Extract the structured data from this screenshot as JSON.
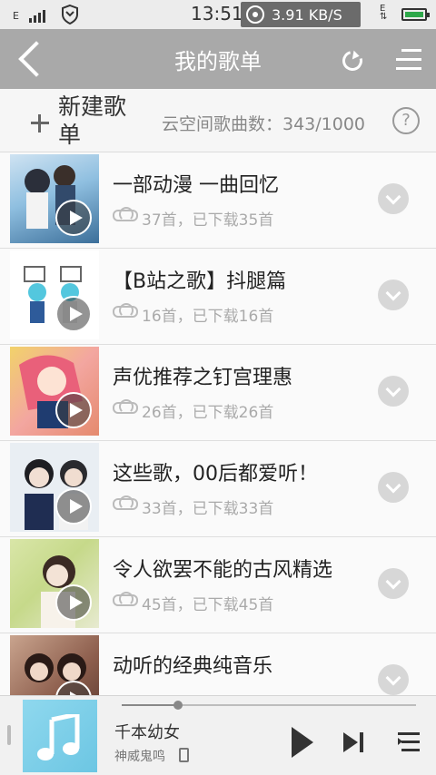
{
  "status_bar": {
    "network": "E",
    "time": "13:51",
    "speed": "3.91 KB/S",
    "data_label": "E"
  },
  "header": {
    "title": "我的歌单"
  },
  "new_bar": {
    "new_label": "新建歌单",
    "cloud_count": "云空间歌曲数：343/1000",
    "help": "?"
  },
  "playlists": [
    {
      "title": "一部动漫 一曲回忆",
      "sub": "37首，已下载35首"
    },
    {
      "title": "【B站之歌】抖腿篇",
      "sub": "16首，已下载16首"
    },
    {
      "title": "声优推荐之钉宫理惠",
      "sub": "26首，已下载26首"
    },
    {
      "title": "这些歌，00后都爱听！",
      "sub": "33首，已下载33首"
    },
    {
      "title": "令人欲罢不能的古风精选",
      "sub": "45首，已下载45首"
    },
    {
      "title": "动听的经典纯音乐",
      "sub": ""
    }
  ],
  "player": {
    "song": "千本幼女",
    "artist": "神威鬼鸣",
    "progress": 0.19
  },
  "colors": {
    "header_bg": "#a9a9a9",
    "accent_green": "#2ea84a",
    "album_bg": "#7fd0ea"
  }
}
